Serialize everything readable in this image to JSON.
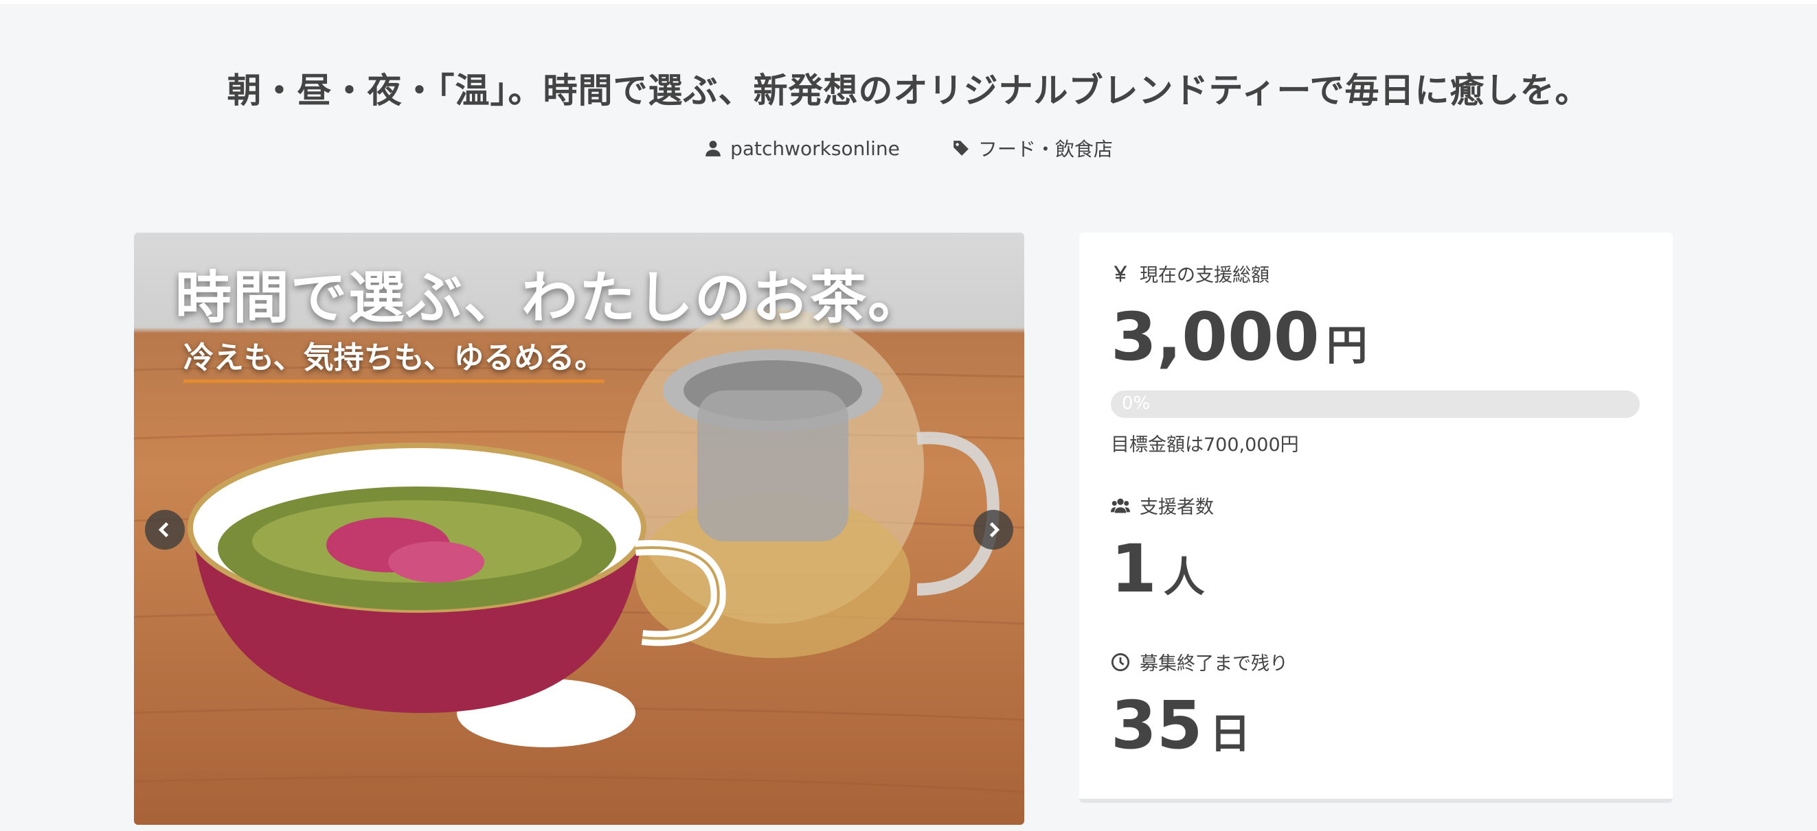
{
  "project": {
    "title": "朝・昼・夜・「温」。時間で選ぶ、新発想のオリジナルブレンドティーで毎日に癒しを。",
    "owner": "patchworksonline",
    "category": "フード・飲食店"
  },
  "hero": {
    "headline": "時間で選ぶ、わたしのお茶。",
    "subheadline": "冷えも、気持ちも、ゆるめる。",
    "prev_icon": "chevron-left-icon",
    "next_icon": "chevron-right-icon"
  },
  "stats": {
    "amount_label": "現在の支援総額",
    "amount_value": "3,000",
    "amount_unit": "円",
    "progress_percent": 0,
    "progress_text": "0%",
    "target_text": "目標金額は700,000円",
    "supporters_label": "支援者数",
    "supporters_value": "1",
    "supporters_unit": "人",
    "remaining_label": "募集終了まで残り",
    "remaining_value": "35",
    "remaining_unit": "日"
  },
  "colors": {
    "background": "#f5f6f8",
    "text": "#444444",
    "progress_track": "#e6e6e6",
    "progress_fill": "#f5a623"
  }
}
